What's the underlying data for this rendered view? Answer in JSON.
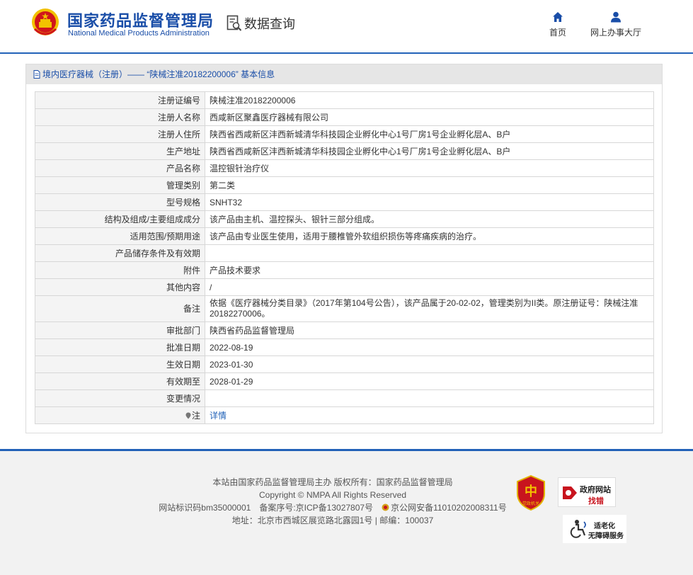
{
  "header": {
    "brand_cn": "国家药品监督管理局",
    "brand_en": "National Medical Products Administration",
    "query_label": "数据查询",
    "nav": {
      "home": "首页",
      "hall": "网上办事大厅"
    }
  },
  "panel": {
    "breadcrumb": "境内医疗器械（注册）—— “陕械注准20182200006” 基本信息",
    "rows": [
      {
        "label": "注册证编号",
        "value": "陕械注准20182200006"
      },
      {
        "label": "注册人名称",
        "value": "西咸新区聚鑫医疗器械有限公司"
      },
      {
        "label": "注册人住所",
        "value": "陕西省西咸新区沣西新城清华科技园企业孵化中心1号厂房1号企业孵化层A、B户"
      },
      {
        "label": "生产地址",
        "value": "陕西省西咸新区沣西新城清华科技园企业孵化中心1号厂房1号企业孵化层A、B户"
      },
      {
        "label": "产品名称",
        "value": "温控银针治疗仪"
      },
      {
        "label": "管理类别",
        "value": "第二类"
      },
      {
        "label": "型号规格",
        "value": "SNHT32"
      },
      {
        "label": "结构及组成/主要组成成分",
        "value": "该产品由主机、温控探头、银针三部分组成。"
      },
      {
        "label": "适用范围/预期用途",
        "value": "该产品由专业医生使用，适用于腰椎管外软组织损伤等疼痛疾病的治疗。"
      },
      {
        "label": "产品储存条件及有效期",
        "value": ""
      },
      {
        "label": "附件",
        "value": "产品技术要求"
      },
      {
        "label": "其他内容",
        "value": "/"
      },
      {
        "label": "备注",
        "value": "依据《医疗器械分类目录》（2017年第104号公告），该产品属于20-02-02，管理类别为II类。原注册证号：陕械注准20182270006。"
      },
      {
        "label": "审批部门",
        "value": "陕西省药品监督管理局"
      },
      {
        "label": "批准日期",
        "value": "2022-08-19"
      },
      {
        "label": "生效日期",
        "value": "2023-01-30"
      },
      {
        "label": "有效期至",
        "value": "2028-01-29"
      },
      {
        "label": "变更情况",
        "value": ""
      }
    ],
    "note_label": "注",
    "note_link": "详情"
  },
  "footer": {
    "line1": "本站由国家药品监督管理局主办 版权所有：国家药品监督管理局",
    "line2": "Copyright © NMPA All Rights Reserved",
    "site_id": "网站标识码bm35000001",
    "icp": "备案序号:京ICP备13027807号",
    "police": "京公网安备11010202008311号",
    "address": "地址：北京市西城区展览路北露园1号 | 邮编：100037",
    "gov_badge_1": "政府网站",
    "gov_badge_2": "找错",
    "old_badge_1": "适老化",
    "old_badge_2": "无障碍服务",
    "party_badge": "党政机关"
  },
  "colors": {
    "brand_blue": "#1a4ea8",
    "accent_blue": "#2262b8",
    "emblem_red": "#d0161b",
    "emblem_gold": "#f2c200"
  }
}
